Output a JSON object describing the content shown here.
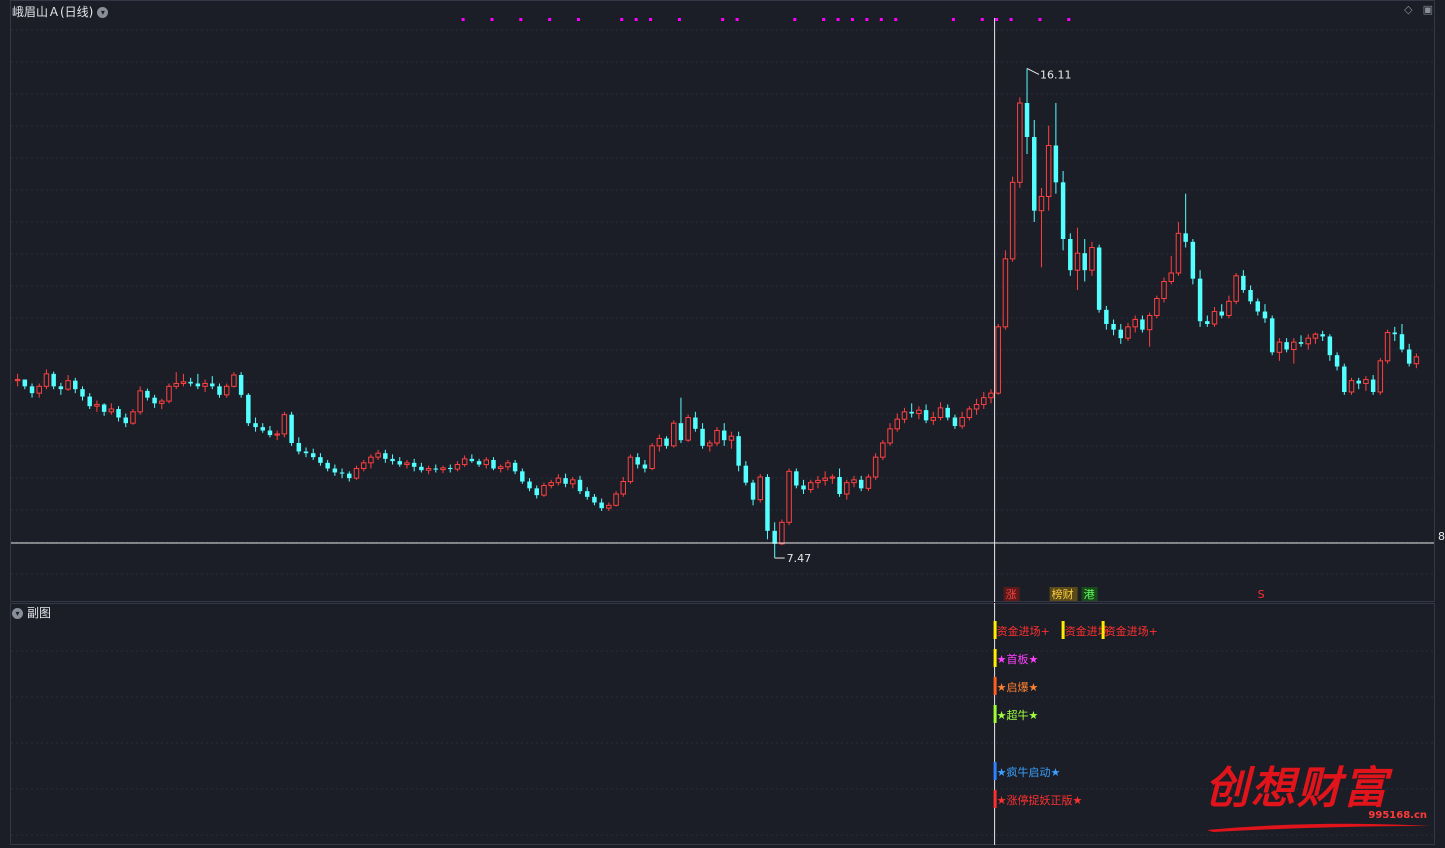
{
  "header": {
    "title": "峨眉山Ａ(日线)",
    "sub_title": "副图",
    "collapse_icon": "chevron-down-icon"
  },
  "toolbar": {
    "diamond_icon": "diamond-icon",
    "square_icon": "square-icon"
  },
  "colors": {
    "up": "#ff4040",
    "down": "#54ffff",
    "grid": "#2a2e3a",
    "crosshair": "#e8e8e8",
    "marker": "#ff00ff"
  },
  "chart_data": {
    "type": "candlestick",
    "title": "峨眉山Ａ(日线)",
    "high_label": "16.11",
    "low_label": "7.47",
    "crosshair_value": "8",
    "ylim": [
      6.8,
      17.0
    ],
    "ohlc": [
      [
        10.6,
        10.72,
        10.5,
        10.62
      ],
      [
        10.62,
        10.62,
        10.45,
        10.5
      ],
      [
        10.5,
        10.55,
        10.3,
        10.38
      ],
      [
        10.38,
        10.55,
        10.3,
        10.5
      ],
      [
        10.5,
        10.8,
        10.45,
        10.72
      ],
      [
        10.72,
        10.76,
        10.45,
        10.5
      ],
      [
        10.5,
        10.56,
        10.35,
        10.45
      ],
      [
        10.45,
        10.7,
        10.42,
        10.6
      ],
      [
        10.6,
        10.65,
        10.38,
        10.45
      ],
      [
        10.45,
        10.5,
        10.25,
        10.32
      ],
      [
        10.32,
        10.38,
        10.1,
        10.15
      ],
      [
        10.15,
        10.25,
        10.05,
        10.18
      ],
      [
        10.18,
        10.2,
        9.98,
        10.05
      ],
      [
        10.05,
        10.2,
        10.0,
        10.1
      ],
      [
        10.1,
        10.15,
        9.88,
        9.95
      ],
      [
        9.95,
        10.02,
        9.78,
        9.85
      ],
      [
        9.85,
        10.1,
        9.82,
        10.05
      ],
      [
        10.05,
        10.5,
        10.0,
        10.42
      ],
      [
        10.42,
        10.46,
        10.25,
        10.3
      ],
      [
        10.3,
        10.35,
        10.12,
        10.2
      ],
      [
        10.2,
        10.28,
        10.1,
        10.24
      ],
      [
        10.24,
        10.55,
        10.2,
        10.5
      ],
      [
        10.5,
        10.75,
        10.45,
        10.55
      ],
      [
        10.55,
        10.72,
        10.5,
        10.58
      ],
      [
        10.58,
        10.65,
        10.5,
        10.55
      ],
      [
        10.55,
        10.72,
        10.45,
        10.5
      ],
      [
        10.5,
        10.62,
        10.4,
        10.55
      ],
      [
        10.55,
        10.68,
        10.45,
        10.5
      ],
      [
        10.5,
        10.55,
        10.3,
        10.35
      ],
      [
        10.35,
        10.55,
        10.3,
        10.5
      ],
      [
        10.5,
        10.75,
        10.48,
        10.7
      ],
      [
        10.7,
        10.75,
        10.3,
        10.35
      ],
      [
        10.35,
        10.38,
        9.8,
        9.85
      ],
      [
        9.85,
        9.95,
        9.7,
        9.78
      ],
      [
        9.78,
        9.85,
        9.68,
        9.72
      ],
      [
        9.72,
        9.8,
        9.6,
        9.64
      ],
      [
        9.64,
        9.72,
        9.55,
        9.66
      ],
      [
        9.66,
        10.05,
        9.6,
        10.0
      ],
      [
        10.0,
        10.05,
        9.45,
        9.5
      ],
      [
        9.5,
        9.6,
        9.3,
        9.35
      ],
      [
        9.35,
        9.42,
        9.25,
        9.32
      ],
      [
        9.32,
        9.4,
        9.2,
        9.25
      ],
      [
        9.25,
        9.32,
        9.1,
        9.15
      ],
      [
        9.15,
        9.2,
        9.0,
        9.05
      ],
      [
        9.05,
        9.12,
        8.92,
        8.98
      ],
      [
        8.98,
        9.05,
        8.88,
        8.96
      ],
      [
        8.96,
        9.0,
        8.82,
        8.88
      ],
      [
        8.88,
        9.1,
        8.85,
        9.05
      ],
      [
        9.05,
        9.2,
        9.0,
        9.15
      ],
      [
        9.15,
        9.3,
        9.05,
        9.25
      ],
      [
        9.25,
        9.38,
        9.2,
        9.32
      ],
      [
        9.32,
        9.38,
        9.15,
        9.22
      ],
      [
        9.22,
        9.3,
        9.12,
        9.18
      ],
      [
        9.18,
        9.25,
        9.08,
        9.12
      ],
      [
        9.12,
        9.2,
        9.05,
        9.15
      ],
      [
        9.15,
        9.22,
        9.0,
        9.08
      ],
      [
        9.08,
        9.15,
        8.98,
        9.02
      ],
      [
        9.02,
        9.1,
        8.95,
        9.05
      ],
      [
        9.05,
        9.12,
        8.98,
        9.03
      ],
      [
        9.03,
        9.1,
        8.97,
        9.06
      ],
      [
        9.06,
        9.12,
        8.98,
        9.04
      ],
      [
        9.04,
        9.18,
        9.0,
        9.12
      ],
      [
        9.12,
        9.28,
        9.08,
        9.22
      ],
      [
        9.22,
        9.3,
        9.15,
        9.18
      ],
      [
        9.18,
        9.22,
        9.08,
        9.12
      ],
      [
        9.12,
        9.25,
        9.05,
        9.2
      ],
      [
        9.2,
        9.25,
        9.02,
        9.05
      ],
      [
        9.05,
        9.12,
        8.98,
        9.08
      ],
      [
        9.08,
        9.2,
        9.02,
        9.15
      ],
      [
        9.15,
        9.2,
        8.95,
        9.0
      ],
      [
        9.0,
        9.05,
        8.78,
        8.82
      ],
      [
        8.82,
        8.88,
        8.65,
        8.7
      ],
      [
        8.7,
        8.75,
        8.52,
        8.58
      ],
      [
        8.58,
        8.8,
        8.55,
        8.75
      ],
      [
        8.75,
        8.85,
        8.7,
        8.8
      ],
      [
        8.8,
        8.95,
        8.75,
        8.88
      ],
      [
        8.88,
        8.96,
        8.72,
        8.78
      ],
      [
        8.78,
        8.9,
        8.7,
        8.85
      ],
      [
        8.85,
        8.92,
        8.6,
        8.65
      ],
      [
        8.65,
        8.72,
        8.5,
        8.55
      ],
      [
        8.55,
        8.6,
        8.4,
        8.45
      ],
      [
        8.45,
        8.52,
        8.3,
        8.35
      ],
      [
        8.35,
        8.45,
        8.3,
        8.4
      ],
      [
        8.4,
        8.65,
        8.38,
        8.6
      ],
      [
        8.6,
        8.9,
        8.55,
        8.82
      ],
      [
        8.82,
        9.3,
        8.78,
        9.25
      ],
      [
        9.25,
        9.32,
        9.05,
        9.12
      ],
      [
        9.12,
        9.2,
        8.98,
        9.05
      ],
      [
        9.05,
        9.5,
        9.02,
        9.45
      ],
      [
        9.45,
        9.65,
        9.35,
        9.58
      ],
      [
        9.58,
        9.62,
        9.4,
        9.45
      ],
      [
        9.45,
        9.9,
        9.42,
        9.85
      ],
      [
        9.85,
        10.3,
        9.5,
        9.55
      ],
      [
        9.55,
        10.0,
        9.52,
        9.95
      ],
      [
        9.95,
        10.05,
        9.7,
        9.75
      ],
      [
        9.75,
        9.85,
        9.4,
        9.45
      ],
      [
        9.45,
        9.55,
        9.35,
        9.5
      ],
      [
        9.5,
        9.78,
        9.45,
        9.72
      ],
      [
        9.72,
        9.85,
        9.45,
        9.55
      ],
      [
        9.55,
        9.7,
        9.4,
        9.62
      ],
      [
        9.62,
        9.7,
        9.0,
        9.1
      ],
      [
        9.1,
        9.18,
        8.75,
        8.8
      ],
      [
        8.8,
        8.85,
        8.4,
        8.5
      ],
      [
        8.5,
        8.95,
        8.45,
        8.9
      ],
      [
        8.9,
        8.95,
        7.8,
        7.95
      ],
      [
        7.95,
        8.1,
        7.47,
        7.72
      ],
      [
        7.72,
        8.15,
        7.7,
        8.1
      ],
      [
        8.1,
        9.05,
        8.05,
        9.0
      ],
      [
        9.0,
        9.05,
        8.7,
        8.75
      ],
      [
        8.75,
        8.85,
        8.6,
        8.68
      ],
      [
        8.68,
        8.85,
        8.62,
        8.8
      ],
      [
        8.8,
        8.92,
        8.7,
        8.84
      ],
      [
        8.84,
        9.0,
        8.75,
        8.88
      ],
      [
        8.88,
        8.95,
        8.78,
        8.9
      ],
      [
        8.9,
        9.05,
        8.55,
        8.6
      ],
      [
        8.6,
        8.85,
        8.5,
        8.8
      ],
      [
        8.8,
        8.92,
        8.72,
        8.85
      ],
      [
        8.85,
        8.92,
        8.65,
        8.7
      ],
      [
        8.7,
        8.95,
        8.65,
        8.9
      ],
      [
        8.9,
        9.32,
        8.85,
        9.25
      ],
      [
        9.25,
        9.55,
        9.2,
        9.5
      ],
      [
        9.5,
        9.85,
        9.45,
        9.75
      ],
      [
        9.75,
        10.02,
        9.7,
        9.92
      ],
      [
        9.92,
        10.12,
        9.85,
        10.05
      ],
      [
        10.05,
        10.2,
        9.95,
        10.02
      ],
      [
        10.02,
        10.15,
        9.92,
        10.08
      ],
      [
        10.08,
        10.18,
        9.85,
        9.9
      ],
      [
        9.9,
        10.05,
        9.82,
        9.95
      ],
      [
        9.95,
        10.22,
        9.9,
        10.12
      ],
      [
        10.12,
        10.18,
        9.9,
        9.95
      ],
      [
        9.95,
        10.0,
        9.75,
        9.8
      ],
      [
        9.8,
        10.05,
        9.75,
        9.95
      ],
      [
        9.95,
        10.15,
        9.9,
        10.1
      ],
      [
        10.1,
        10.28,
        10.0,
        10.18
      ],
      [
        10.18,
        10.4,
        10.1,
        10.3
      ],
      [
        10.3,
        10.45,
        10.2,
        10.38
      ],
      [
        10.38,
        11.6,
        10.35,
        11.55
      ],
      [
        11.55,
        12.9,
        11.5,
        12.75
      ],
      [
        12.75,
        14.2,
        12.7,
        14.1
      ],
      [
        14.1,
        15.6,
        14.0,
        15.5
      ],
      [
        15.5,
        16.11,
        14.6,
        14.9
      ],
      [
        14.9,
        15.2,
        13.4,
        13.6
      ],
      [
        13.6,
        14.0,
        12.6,
        13.85
      ],
      [
        13.85,
        15.1,
        13.6,
        14.75
      ],
      [
        14.75,
        15.5,
        13.9,
        14.1
      ],
      [
        14.1,
        14.3,
        12.9,
        13.1
      ],
      [
        13.1,
        13.2,
        12.45,
        12.55
      ],
      [
        12.55,
        13.3,
        12.2,
        12.85
      ],
      [
        12.85,
        13.1,
        12.35,
        12.55
      ],
      [
        12.55,
        13.05,
        12.45,
        12.95
      ],
      [
        12.95,
        13.0,
        11.8,
        11.85
      ],
      [
        11.85,
        11.92,
        11.5,
        11.6
      ],
      [
        11.6,
        11.68,
        11.4,
        11.5
      ],
      [
        11.5,
        11.6,
        11.25,
        11.35
      ],
      [
        11.35,
        11.62,
        11.3,
        11.55
      ],
      [
        11.55,
        11.75,
        11.45,
        11.68
      ],
      [
        11.68,
        11.75,
        11.45,
        11.5
      ],
      [
        11.5,
        11.8,
        11.2,
        11.75
      ],
      [
        11.75,
        12.1,
        11.7,
        12.05
      ],
      [
        12.05,
        12.42,
        11.98,
        12.35
      ],
      [
        12.35,
        12.8,
        12.3,
        12.5
      ],
      [
        12.5,
        13.4,
        12.45,
        13.2
      ],
      [
        13.2,
        13.9,
        12.95,
        13.05
      ],
      [
        13.05,
        13.1,
        12.3,
        12.4
      ],
      [
        12.4,
        12.55,
        11.55,
        11.65
      ],
      [
        11.65,
        11.75,
        11.55,
        11.6
      ],
      [
        11.6,
        11.9,
        11.55,
        11.82
      ],
      [
        11.82,
        11.95,
        11.7,
        11.75
      ],
      [
        11.75,
        12.1,
        11.7,
        12.0
      ],
      [
        12.0,
        12.5,
        11.95,
        12.45
      ],
      [
        12.45,
        12.55,
        12.15,
        12.2
      ],
      [
        12.2,
        12.28,
        11.95,
        12.0
      ],
      [
        12.0,
        12.05,
        11.75,
        11.82
      ],
      [
        11.82,
        11.95,
        11.62,
        11.7
      ],
      [
        11.7,
        11.75,
        11.05,
        11.1
      ],
      [
        11.1,
        11.35,
        10.95,
        11.28
      ],
      [
        11.28,
        11.35,
        11.1,
        11.15
      ],
      [
        11.15,
        11.35,
        10.9,
        11.28
      ],
      [
        11.28,
        11.4,
        11.2,
        11.25
      ],
      [
        11.25,
        11.42,
        11.15,
        11.35
      ],
      [
        11.35,
        11.45,
        11.25,
        11.42
      ],
      [
        11.42,
        11.48,
        11.3,
        11.38
      ],
      [
        11.38,
        11.42,
        10.95,
        11.05
      ],
      [
        11.05,
        11.1,
        10.78,
        10.85
      ],
      [
        10.85,
        10.9,
        10.35,
        10.4
      ],
      [
        10.4,
        10.65,
        10.35,
        10.6
      ],
      [
        10.6,
        10.65,
        10.45,
        10.55
      ],
      [
        10.55,
        10.68,
        10.42,
        10.62
      ],
      [
        10.62,
        10.7,
        10.35,
        10.4
      ],
      [
        10.4,
        11.0,
        10.35,
        10.95
      ],
      [
        10.95,
        11.5,
        10.9,
        11.45
      ],
      [
        11.45,
        11.55,
        11.3,
        11.42
      ],
      [
        11.42,
        11.6,
        11.1,
        11.15
      ],
      [
        11.15,
        11.25,
        10.85,
        10.9
      ],
      [
        10.9,
        11.08,
        10.82,
        11.02
      ]
    ],
    "top_markers": [
      30,
      32,
      34,
      36,
      38,
      41,
      42,
      43,
      45,
      48,
      49,
      53,
      55,
      56,
      57,
      58,
      59,
      60,
      64,
      66,
      67,
      68,
      70,
      72
    ],
    "main_signals": [
      {
        "label": "涨",
        "color": "#ff4040",
        "bg": "#5a1a1a"
      },
      {
        "label": "榜财",
        "color": "#ffd040",
        "bg": "#5a4a1a"
      },
      {
        "label": "港",
        "color": "#60ff60",
        "bg": "#1a4a1a"
      },
      {
        "label": "S",
        "color": "#ff3030",
        "bg": ""
      }
    ]
  },
  "sub_chart": {
    "rows": [
      {
        "labels": [
          "资金进场+",
          "资金进场",
          "资金进场+"
        ],
        "text_color": "#ff3030",
        "bar_color": "#ffee00"
      },
      {
        "labels": [
          "★首板★"
        ],
        "text_color": "#ff40ff",
        "bar_color": "#ffee00"
      },
      {
        "labels": [
          "★启爆★"
        ],
        "text_color": "#ff8030",
        "bar_color": "#ff6020"
      },
      {
        "labels": [
          "★超牛★"
        ],
        "text_color": "#a0ff40",
        "bar_color": "#a0ff30"
      },
      {
        "labels": [
          "★疯牛启动★"
        ],
        "text_color": "#3aa0ff",
        "bar_color": "#3080ff"
      },
      {
        "labels": [
          "★涨停捉妖正版★"
        ],
        "text_color": "#ff3030",
        "bar_color": "#ff3030"
      }
    ]
  },
  "watermark": {
    "text": "创想财富",
    "url": "995168.cn"
  }
}
